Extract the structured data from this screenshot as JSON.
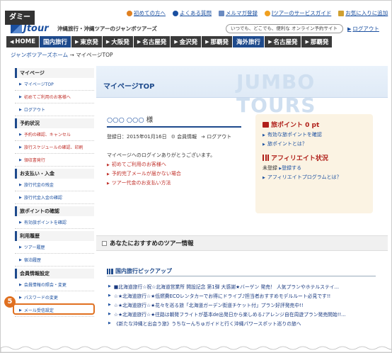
{
  "dummy_label": "ダミー",
  "step_badge": "5",
  "header": {
    "logo_text": "Jtour",
    "tagline": "沖縄旅行・沖縄ツアーのジャンボツアーズ",
    "top_links": [
      {
        "label": "初めての方へ",
        "icon": "info-icon"
      },
      {
        "label": "よくある質問",
        "icon": "question-icon"
      },
      {
        "label": "メルマガ登録",
        "icon": "mail-icon"
      },
      {
        "label": "Jツアーのサービスガイド",
        "icon": "guide-icon"
      },
      {
        "label": "お気に入りに追加",
        "icon": "favorite-icon"
      }
    ],
    "search_placeholder": "いつでも、どこでも、便利な オンライン予約サイト",
    "login_label": "ログアウト"
  },
  "nav": [
    {
      "label": "HOME",
      "arrow": "◀",
      "blue": false
    },
    {
      "label": "国内旅行",
      "arrow": "",
      "blue": true
    },
    {
      "label": "東京発",
      "arrow": "▶",
      "blue": false
    },
    {
      "label": "大阪発",
      "arrow": "▶",
      "blue": false
    },
    {
      "label": "名古屋発",
      "arrow": "▶",
      "blue": false
    },
    {
      "label": "金沢発",
      "arrow": "▶",
      "blue": false
    },
    {
      "label": "那覇発",
      "arrow": "▶",
      "blue": false
    },
    {
      "label": "海外旅行",
      "arrow": "",
      "blue": true
    },
    {
      "label": "名古屋発",
      "arrow": "▶",
      "blue": false
    },
    {
      "label": "那覇発",
      "arrow": "▶",
      "blue": false
    }
  ],
  "breadcrumb": {
    "home": "ジャンボツアーズホーム",
    "sep": " → ",
    "current": "マイページTOP"
  },
  "sidebar": [
    {
      "heading": "マイページ",
      "items": [
        {
          "label": "マイページTOP",
          "red": false
        },
        {
          "label": "初めてご利用のお客様へ",
          "red": true
        },
        {
          "label": "ログアウト",
          "red": false
        }
      ]
    },
    {
      "heading": "予約状況",
      "items": [
        {
          "label": "予約の確認、キャンセル",
          "red": true
        },
        {
          "label": "旅行スケジュールの確認、印刷",
          "red": true
        },
        {
          "label": "領収書発行",
          "red": true
        }
      ]
    },
    {
      "heading": "お支払い・入金",
      "items": [
        {
          "label": "旅行代金の残金",
          "red": false
        },
        {
          "label": "旅行代金入金の確認",
          "red": false
        }
      ]
    },
    {
      "heading": "旅ポイントの確認",
      "items": [
        {
          "label": "有効旅ポイントを確認",
          "red": false
        }
      ]
    },
    {
      "heading": "利用履歴",
      "items": [
        {
          "label": "ツアー履歴",
          "red": false
        },
        {
          "label": "宿泊履歴",
          "red": false
        }
      ]
    },
    {
      "heading": "会員情報設定",
      "items": [
        {
          "label": "会員情報の照会・変更",
          "red": false
        },
        {
          "label": "パスワードの変更",
          "red": false
        },
        {
          "label": "メール受信設定",
          "red": false
        }
      ]
    }
  ],
  "banner": {
    "title": "マイページTOP",
    "watermark": "JUMBO TOURS"
  },
  "user": {
    "name": "○○○ ○○○",
    "honorific": " 様",
    "registered": "登録日：2015年01月16日",
    "member_info": "会員情報",
    "logout": "ログアウト",
    "welcome": "マイページへのログインありがとうございます。",
    "links": [
      "初めてご利用のお客様へ",
      "予約完了メールが届かない場合",
      "ツアー代金のお支払い方法"
    ]
  },
  "points": {
    "title": "旅ポイント 0 pt",
    "links": [
      "有効な旅ポイントを確認",
      "旅ポイントとは？"
    ],
    "affiliate_title": "アフィリエイト状況",
    "unregistered": "未登録",
    "register": "登録する",
    "affiliate_link": "アフィリエイトプログラムとは？"
  },
  "recommend": {
    "title": "あなたにおすすめのツアー情報"
  },
  "pickup": {
    "title": "国内旅行ピックアップ",
    "tours": [
      "■北海道旅行☆祝☆北海道営業所 開設記念 第1弾 大感謝★バーゲン 発売！ 人気プランやホテルステイ...",
      "☆★北海道旅行☆★低燃費ECOレンタカーでお得にドライブ♪担当者おすすめモデルルート必見です!!",
      "☆★北海道旅行☆★花々を巡る旅「北海道ガーデン街道チケット付」プラン好評発売中!!",
      "☆★北海道旅行☆★往路は朝発フライトが基本de出発日から楽しめる♪アレンジ自在周遊プラン発売開始!!...",
      "《新たな沖縄と出会う旅》うちなーんちゅガイドと行く沖縄パワースポット巡りの旅へ"
    ]
  }
}
